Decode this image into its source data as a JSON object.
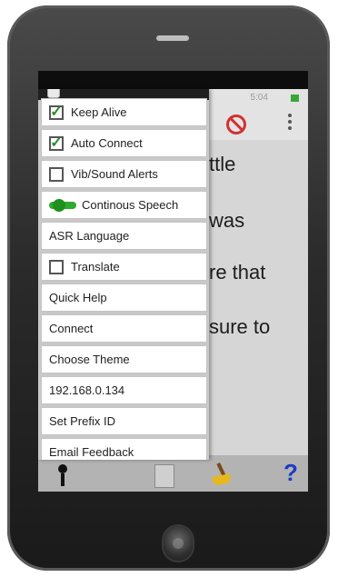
{
  "status": {
    "time": "5:04"
  },
  "main": {
    "text_lines": [
      "ttle",
      "was",
      "re that",
      "sure to"
    ]
  },
  "menu": {
    "items": [
      {
        "label": "Keep Alive",
        "control": "checkbox",
        "checked": true
      },
      {
        "label": "Auto Connect",
        "control": "checkbox",
        "checked": true
      },
      {
        "label": "Vib/Sound Alerts",
        "control": "checkbox",
        "checked": false
      },
      {
        "label": "Continous Speech",
        "control": "toggle",
        "on": true
      },
      {
        "label": "ASR Language",
        "control": "none"
      },
      {
        "label": "Translate",
        "control": "checkbox",
        "checked": false
      },
      {
        "label": "Quick Help",
        "control": "none"
      },
      {
        "label": "Connect",
        "control": "none"
      },
      {
        "label": "Choose Theme",
        "control": "none"
      },
      {
        "label": "192.168.0.134",
        "control": "none"
      },
      {
        "label": "Set Prefix ID",
        "control": "none"
      },
      {
        "label": "Email Feedback",
        "control": "none"
      }
    ]
  },
  "icons": {
    "header": "app-icon",
    "appbar_block": "no-sign-icon",
    "appbar_overflow": "overflow-menu-icon",
    "bottom": [
      "microphone-icon",
      "document-icon",
      "broom-icon",
      "help-icon"
    ]
  },
  "colors": {
    "accent_green": "#2eaa2e",
    "help_blue": "#1a3cc8",
    "block_red": "#d03232"
  }
}
